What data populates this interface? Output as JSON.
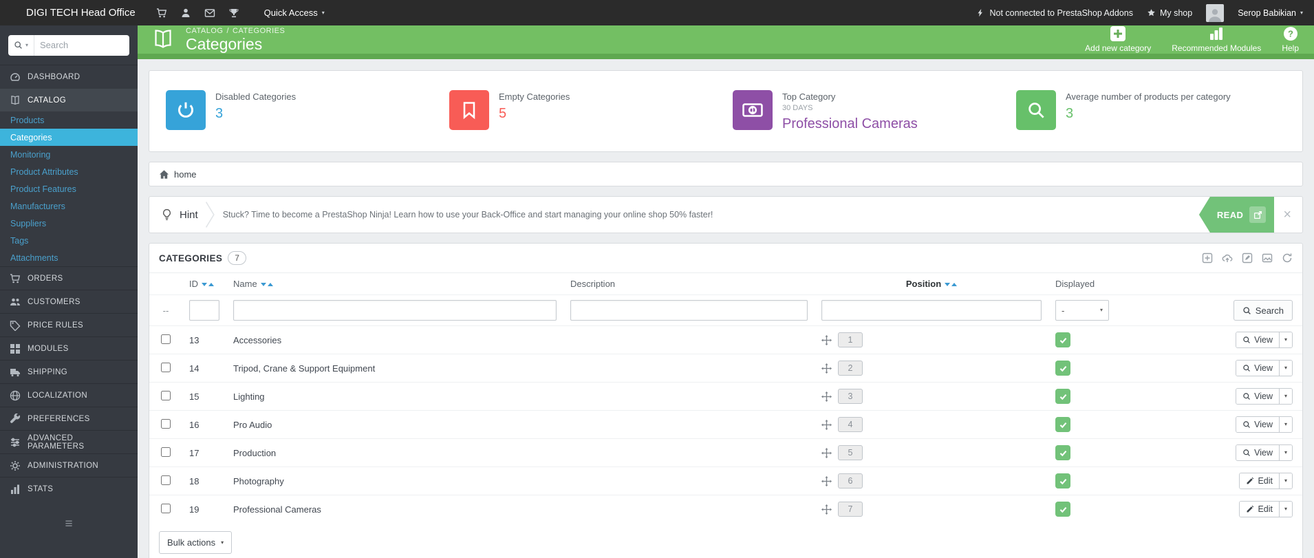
{
  "colors": {
    "header-green": "#73bf63",
    "header-green-dark": "#5fa850",
    "accent-green": "#72c279",
    "accent-blue": "#3db4dc",
    "link-blue": "#4aa0cc",
    "kpi-blue": "#36a3d9",
    "kpi-red": "#f85c56",
    "kpi-purple": "#8e4fa6",
    "kpi-green": "#67c06a"
  },
  "icons": {
    "caret_down": "▾",
    "close": "×",
    "menu_collapse": "≡"
  },
  "topbar": {
    "shop_name": "DIGI TECH Head Office",
    "quick_access": "Quick Access",
    "addons_status": "Not connected to PrestaShop Addons",
    "my_shop": "My shop",
    "employee_name": "Serop Babikian"
  },
  "sidebar": {
    "search_placeholder": "Search",
    "items": [
      {
        "label": "DASHBOARD"
      },
      {
        "label": "CATALOG"
      },
      {
        "label": "ORDERS"
      },
      {
        "label": "CUSTOMERS"
      },
      {
        "label": "PRICE RULES"
      },
      {
        "label": "MODULES"
      },
      {
        "label": "SHIPPING"
      },
      {
        "label": "LOCALIZATION"
      },
      {
        "label": "PREFERENCES"
      },
      {
        "label": "ADVANCED PARAMETERS"
      },
      {
        "label": "ADMINISTRATION"
      },
      {
        "label": "STATS"
      }
    ],
    "catalog_submenu": [
      {
        "label": "Products"
      },
      {
        "label": "Categories",
        "active": true
      },
      {
        "label": "Monitoring"
      },
      {
        "label": "Product Attributes"
      },
      {
        "label": "Product Features"
      },
      {
        "label": "Manufacturers"
      },
      {
        "label": "Suppliers"
      },
      {
        "label": "Tags"
      },
      {
        "label": "Attachments"
      }
    ]
  },
  "page_header": {
    "breadcrumb_section": "CATALOG",
    "breadcrumb_separator": "/",
    "breadcrumb_page": "CATEGORIES",
    "title": "Categories",
    "add_new": "Add new category",
    "recommended_modules": "Recommended Modules",
    "help": "Help"
  },
  "kpis": [
    {
      "label": "Disabled Categories",
      "value": "3"
    },
    {
      "label": "Empty Categories",
      "value": "5"
    },
    {
      "label": "Top Category",
      "period": "30 DAYS",
      "value": "Professional Cameras"
    },
    {
      "label": "Average number of products per category",
      "value": "3"
    }
  ],
  "breadcrumb": {
    "home": "home"
  },
  "hint": {
    "label": "Hint",
    "text": "Stuck? Time to become a PrestaShop Ninja! Learn how to use your Back-Office and start managing your online shop 50% faster!",
    "read": "READ"
  },
  "list": {
    "title": "CATEGORIES",
    "count": "7",
    "headers": {
      "id": "ID",
      "name": "Name",
      "description": "Description",
      "position": "Position",
      "displayed": "Displayed"
    },
    "filter": {
      "empty_marker": "--",
      "displayed_option": "-",
      "search": "Search"
    },
    "rows": [
      {
        "id": "13",
        "name": "Accessories",
        "position": "1",
        "displayed": true,
        "action": "View"
      },
      {
        "id": "14",
        "name": "Tripod, Crane & Support Equipment",
        "position": "2",
        "displayed": true,
        "action": "View"
      },
      {
        "id": "15",
        "name": "Lighting",
        "position": "3",
        "displayed": true,
        "action": "View"
      },
      {
        "id": "16",
        "name": "Pro Audio",
        "position": "4",
        "displayed": true,
        "action": "View"
      },
      {
        "id": "17",
        "name": "Production",
        "position": "5",
        "displayed": true,
        "action": "View"
      },
      {
        "id": "18",
        "name": "Photography",
        "position": "6",
        "displayed": true,
        "action": "Edit"
      },
      {
        "id": "19",
        "name": "Professional Cameras",
        "position": "7",
        "displayed": true,
        "action": "Edit"
      }
    ],
    "bulk_actions": "Bulk actions"
  }
}
